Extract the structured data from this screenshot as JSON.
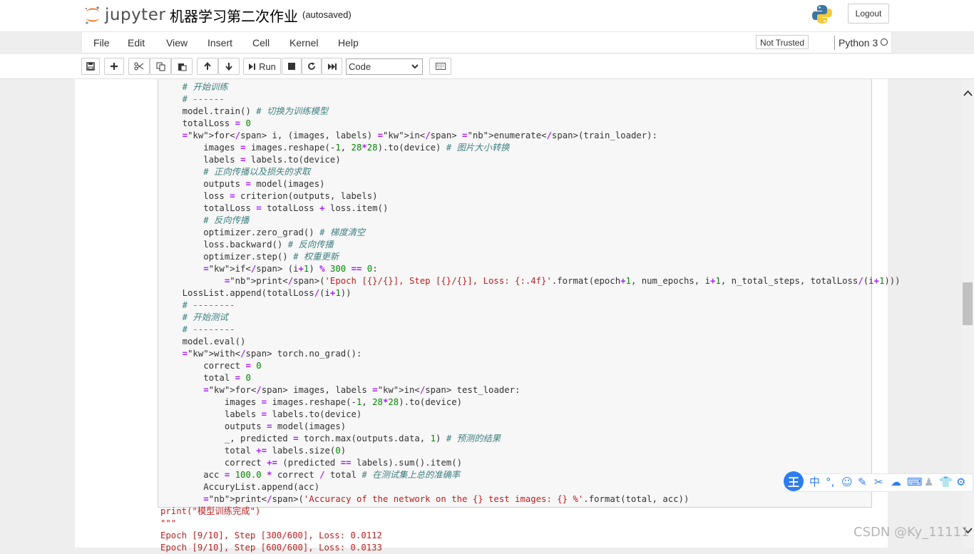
{
  "header": {
    "logo_text": "jupyter",
    "notebook_name": "机器学习第二次作业",
    "autosave_status": "(autosaved)",
    "logout_label": "Logout"
  },
  "menubar": {
    "items": [
      "File",
      "Edit",
      "View",
      "Insert",
      "Cell",
      "Kernel",
      "Help"
    ],
    "trust_status": "Not Trusted",
    "kernel_name": "Python 3"
  },
  "toolbar": {
    "run_label": "Run",
    "cell_type": "Code"
  },
  "code_lines": [
    "    # 开始训练",
    "    # ------",
    "    model.train() # 切换为训练模型",
    "    totalLoss = 0",
    "    for i, (images, labels) in enumerate(train_loader):",
    "        images = images.reshape(-1, 28*28).to(device) # 图片大小转换",
    "        labels = labels.to(device)",
    "        # 正向传播以及损失的求取",
    "        outputs = model(images)",
    "        loss = criterion(outputs, labels)",
    "        totalLoss = totalLoss + loss.item()",
    "        # 反向传播",
    "        optimizer.zero_grad() # 梯度清空",
    "        loss.backward() # 反向传播",
    "        optimizer.step() # 权重更新",
    "        if (i+1) % 300 == 0:",
    "            print('Epoch [{}/{}], Step [{}/{}], Loss: {:.4f}'.format(epoch+1, num_epochs, i+1, n_total_steps, totalLoss/(i+1)))",
    "    LossList.append(totalLoss/(i+1))",
    "    # --------",
    "    # 开始测试",
    "    # --------",
    "    model.eval()",
    "    with torch.no_grad():",
    "        correct = 0",
    "        total = 0",
    "        for images, labels in test_loader:",
    "            images = images.reshape(-1, 28*28).to(device)",
    "            labels = labels.to(device)",
    "            outputs = model(images)",
    "            _, predicted = torch.max(outputs.data, 1) # 预测的结果",
    "            total += labels.size(0)",
    "            correct += (predicted == labels).sum().item()",
    "        acc = 100.0 * correct / total # 在测试集上总的准确率",
    "        AccuryList.append(acc)",
    "        print('Accuracy of the network on the {} test images: {} %'.format(total, acc))"
  ],
  "trailing_lines": [
    "print(\"模型训练完成\")",
    "\"\"\"",
    "Epoch [9/10], Step [300/600], Loss: 0.0112",
    "Epoch [9/10], Step [600/600], Loss: 0.0133"
  ],
  "ime": {
    "logo": "王",
    "icons": [
      "中",
      "°,",
      "☺",
      "✎",
      "✂",
      "☁",
      "⌨",
      "♟",
      "👕",
      "⚙"
    ]
  },
  "watermark": "CSDN @Ky_11111"
}
